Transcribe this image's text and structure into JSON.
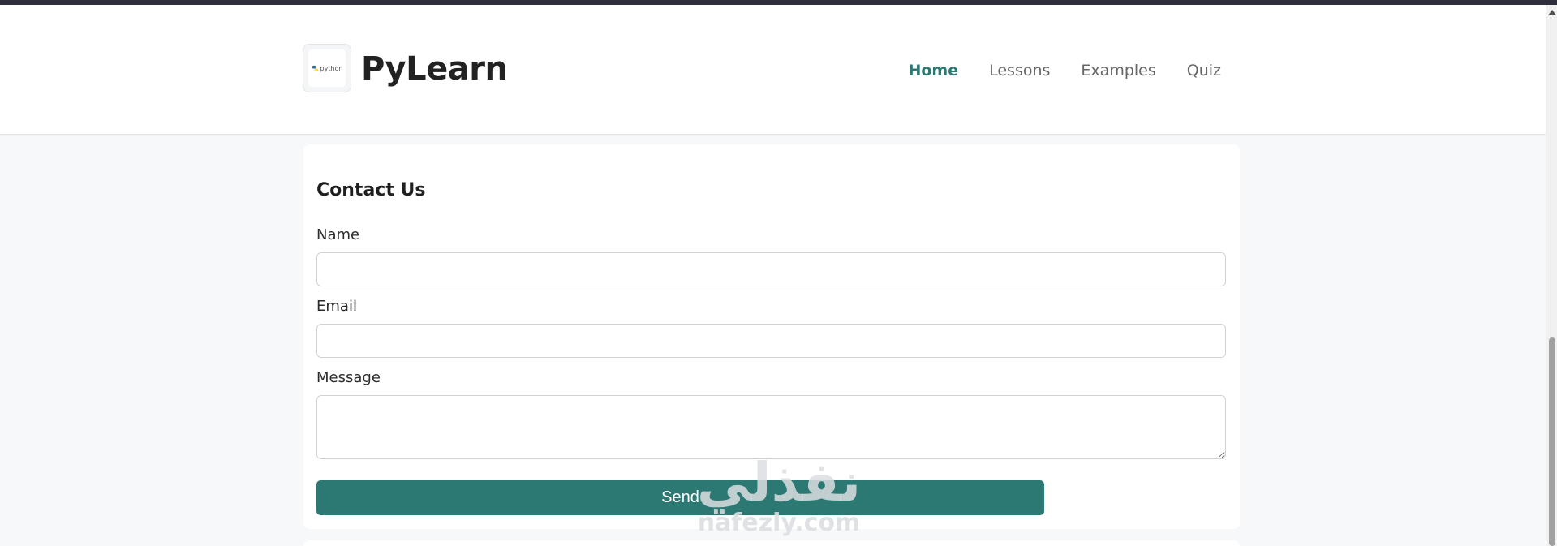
{
  "header": {
    "logo_text": "python",
    "brand": "PyLearn",
    "nav": [
      {
        "label": "Home",
        "active": true
      },
      {
        "label": "Lessons",
        "active": false
      },
      {
        "label": "Examples",
        "active": false
      },
      {
        "label": "Quiz",
        "active": false
      }
    ]
  },
  "contact": {
    "title": "Contact Us",
    "name_label": "Name",
    "name_value": "",
    "email_label": "Email",
    "email_value": "",
    "message_label": "Message",
    "message_value": "",
    "send_label": "Send"
  },
  "watermark": {
    "arabic": "نفذلي",
    "latin": "nafezly.com"
  },
  "colors": {
    "accent": "#2c7873",
    "background": "#f7f8fa",
    "card": "#ffffff"
  }
}
